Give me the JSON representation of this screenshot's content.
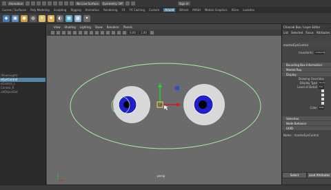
{
  "topbar": {
    "items": [
      "Animation",
      "No Live Surface",
      "Symmetry: Off",
      "Sign In"
    ]
  },
  "tabs": [
    "Curves / Surfaces",
    "Poly Modeling",
    "Sculpting",
    "Rigging",
    "Animation",
    "Rendering",
    "FX",
    "FX Caching",
    "Custom",
    "Arnold",
    "Bifrost",
    "MASH",
    "Motion Graphics",
    "XGen",
    "Lookdev"
  ],
  "active_tab": "Arnold",
  "viewport": {
    "menus": [
      "View",
      "Shading",
      "Lighting",
      "Show",
      "Renderer",
      "Panels"
    ],
    "fields": [
      "0.00",
      "1.00"
    ],
    "camera_label": "persp"
  },
  "outliner": {
    "rows": [
      "",
      "",
      "",
      "",
      "",
      "",
      "",
      "(Rewrought)",
      "eEyeControl",
      "eControl_L",
      "Control_R",
      "ultObjectSet"
    ],
    "selected": "eEyeControl"
  },
  "channel_box": {
    "title": "Channel Box / Layer Editor",
    "menus": [
      "List",
      "Selected",
      "Focus",
      "Attributes"
    ],
    "node_name": "masterEyeControl",
    "transform_label": "transform:",
    "transform_value": "masterEy",
    "sections": [
      "Bounding Box Information",
      "Mental Ray",
      "Display",
      "Selection",
      "Node Behavior",
      "UUID"
    ],
    "display_override": "Drawing Overrides",
    "display_type_label": "Display Type",
    "display_type_value": "Norm",
    "level_of_detail_label": "Level of Detail",
    "level_of_detail_value": "Full",
    "color_label": "Color",
    "color_value": "RGB",
    "notes": "Notes : masterEyeControl",
    "select_button": "Select",
    "load_button": "Load Attributes"
  }
}
